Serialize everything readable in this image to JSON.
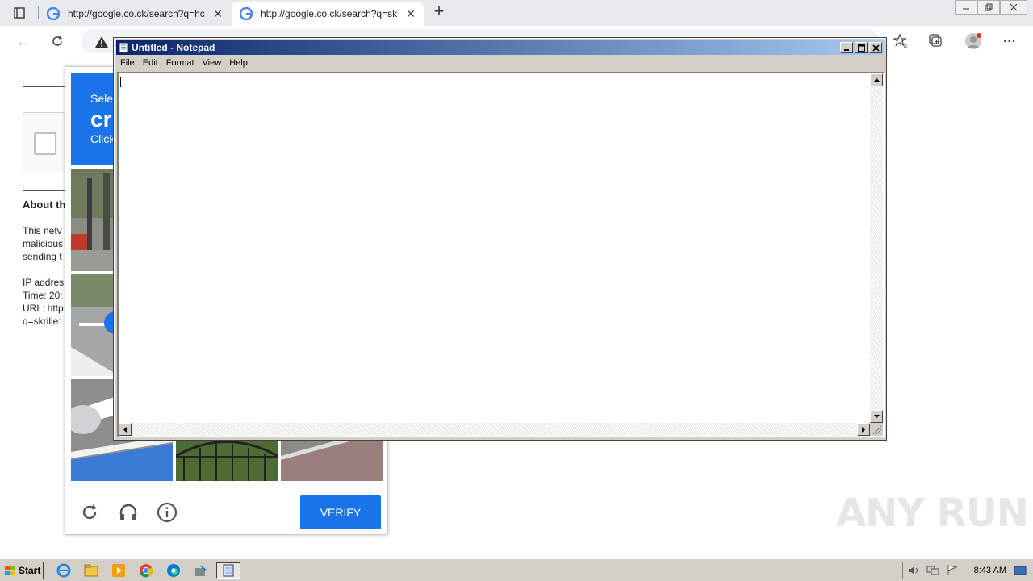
{
  "browser": {
    "tabs": [
      {
        "title": "http://google.co.ck/search?q=hc",
        "active": false
      },
      {
        "title": "http://google.co.ck/search?q=sk",
        "active": true
      }
    ],
    "new_tab_label": "+"
  },
  "page": {
    "about_heading": "About th",
    "lines": [
      "This netv",
      "malicious",
      "sending t",
      "IP addres",
      "Time: 20:",
      "URL: http",
      "q=skrille:"
    ]
  },
  "captcha": {
    "header_line1": "Selec",
    "header_line2": "cr",
    "header_line3": "Click",
    "verify_label": "VERIFY"
  },
  "notepad": {
    "title": "Untitled - Notepad",
    "menu": [
      "File",
      "Edit",
      "Format",
      "View",
      "Help"
    ],
    "content": ""
  },
  "watermark": "ANY RUN",
  "taskbar": {
    "start_label": "Start",
    "clock": "8:43 AM"
  },
  "colors": {
    "accent": "#1a73e8",
    "titlebar_start": "#0a246a",
    "titlebar_end": "#a6caf0",
    "taskbar": "#d4d0c8"
  }
}
